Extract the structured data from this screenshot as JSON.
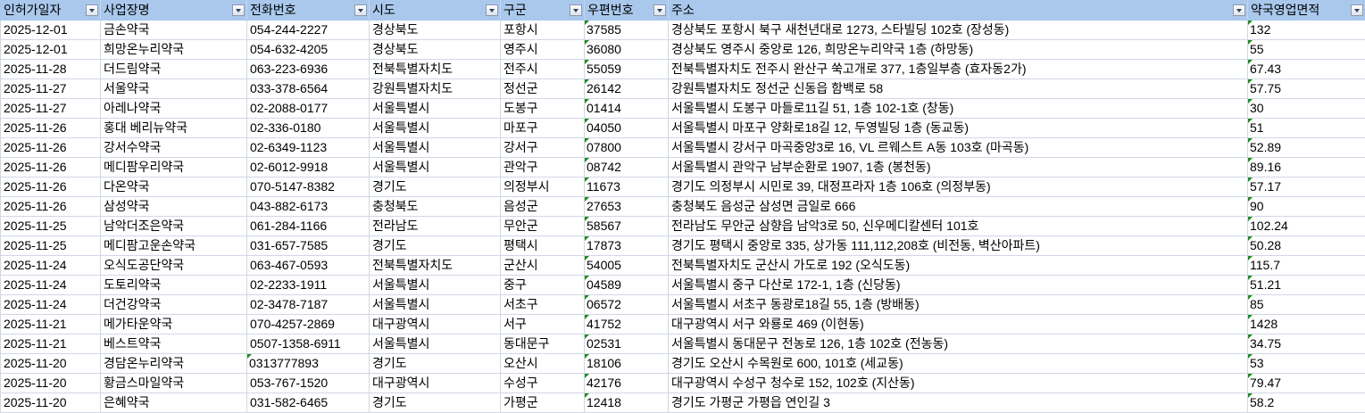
{
  "columns": [
    "인허가일자",
    "사업장명",
    "전화번호",
    "시도",
    "구군",
    "우편번호",
    "주소",
    "약국영업면적"
  ],
  "rows": [
    [
      "2025-12-01",
      "금손약국",
      "054-244-2227",
      "경상북도",
      "포항시",
      "37585",
      "경상북도 포항시 북구 새천년대로 1273, 스타빌딩 102호 (장성동)",
      "132"
    ],
    [
      "2025-12-01",
      "희망온누리약국",
      "054-632-4205",
      "경상북도",
      "영주시",
      "36080",
      "경상북도 영주시 중앙로 126, 희망온누리약국 1층 (하망동)",
      "55"
    ],
    [
      "2025-11-28",
      "더드림약국",
      "063-223-6936",
      "전북특별자치도",
      "전주시",
      "55059",
      "전북특별자치도 전주시 완산구 쑥고개로 377, 1층일부층 (효자동2가)",
      "67.43"
    ],
    [
      "2025-11-27",
      "서울약국",
      "033-378-6564",
      "강원특별자치도",
      "정선군",
      "26142",
      "강원특별자치도 정선군 신동읍 함백로 58",
      "57.75"
    ],
    [
      "2025-11-27",
      "아레나약국",
      "02-2088-0177",
      "서울특별시",
      "도봉구",
      "01414",
      "서울특별시 도봉구 마들로11길 51, 1층 102-1호 (창동)",
      "30"
    ],
    [
      "2025-11-26",
      "홍대 베리뉴약국",
      "02-336-0180",
      "서울특별시",
      "마포구",
      "04050",
      "서울특별시 마포구 양화로18길 12, 두영빌딩 1층 (동교동)",
      "51"
    ],
    [
      "2025-11-26",
      "강서수약국",
      "02-6349-1123",
      "서울특별시",
      "강서구",
      "07800",
      "서울특별시 강서구 마곡중앙3로 16, VL 르웨스트 A동 103호 (마곡동)",
      "52.89"
    ],
    [
      "2025-11-26",
      "메디팜우리약국",
      "02-6012-9918",
      "서울특별시",
      "관악구",
      "08742",
      "서울특별시 관악구 남부순환로 1907, 1층 (봉천동)",
      "89.16"
    ],
    [
      "2025-11-26",
      "다온약국",
      "070-5147-8382",
      "경기도",
      "의정부시",
      "11673",
      "경기도 의정부시 시민로 39, 대정프라자 1층 106호 (의정부동)",
      "57.17"
    ],
    [
      "2025-11-26",
      "삼성약국",
      "043-882-6173",
      "충청북도",
      "음성군",
      "27653",
      "충청북도 음성군 삼성면 금일로 666",
      "90"
    ],
    [
      "2025-11-25",
      "남악더조은약국",
      "061-284-1166",
      "전라남도",
      "무안군",
      "58567",
      "전라남도 무안군 삼향읍 남악3로 50, 신우메디칼센터 101호",
      "102.24"
    ],
    [
      "2025-11-25",
      "메디팜고운손약국",
      "031-657-7585",
      "경기도",
      "평택시",
      "17873",
      "경기도 평택시 중앙로 335, 상가동 111,112,208호 (비전동, 벽산아파트)",
      "50.28"
    ],
    [
      "2025-11-24",
      "오식도공단약국",
      "063-467-0593",
      "전북특별자치도",
      "군산시",
      "54005",
      "전북특별자치도 군산시 가도로 192 (오식도동)",
      "115.7"
    ],
    [
      "2025-11-24",
      "도토리약국",
      "02-2233-1911",
      "서울특별시",
      "중구",
      "04589",
      "서울특별시 중구 다산로 172-1, 1층 (신당동)",
      "51.21"
    ],
    [
      "2025-11-24",
      "더건강약국",
      "02-3478-7187",
      "서울특별시",
      "서초구",
      "06572",
      "서울특별시 서초구 동광로18길 55, 1층 (방배동)",
      "85"
    ],
    [
      "2025-11-21",
      "메가타운약국",
      "070-4257-2869",
      "대구광역시",
      "서구",
      "41752",
      "대구광역시 서구 와룡로 469 (이현동)",
      "1428"
    ],
    [
      "2025-11-21",
      "베스트약국",
      "0507-1358-6911",
      "서울특별시",
      "동대문구",
      "02531",
      "서울특별시 동대문구 전농로 126, 1층 102호 (전농동)",
      "34.75"
    ],
    [
      "2025-11-20",
      "경담온누리약국",
      "0313777893",
      "경기도",
      "오산시",
      "18106",
      "경기도 오산시 수목원로 600, 101호 (세교동)",
      "53"
    ],
    [
      "2025-11-20",
      "황금스마일약국",
      "053-767-1520",
      "대구광역시",
      "수성구",
      "42176",
      "대구광역시 수성구 청수로 152, 102호 (지산동)",
      "79.47"
    ],
    [
      "2025-11-20",
      "은혜약국",
      "031-582-6465",
      "경기도",
      "가평군",
      "12418",
      "경기도 가평군 가평읍 연인길 3",
      "58.2"
    ]
  ],
  "text_number_flags": {
    "phone_as_text_rows": [
      17
    ]
  },
  "colors": {
    "header_bg": "#a9c8ec",
    "grid": "#d0d7e5",
    "text_flag": "#1e8a1e"
  }
}
